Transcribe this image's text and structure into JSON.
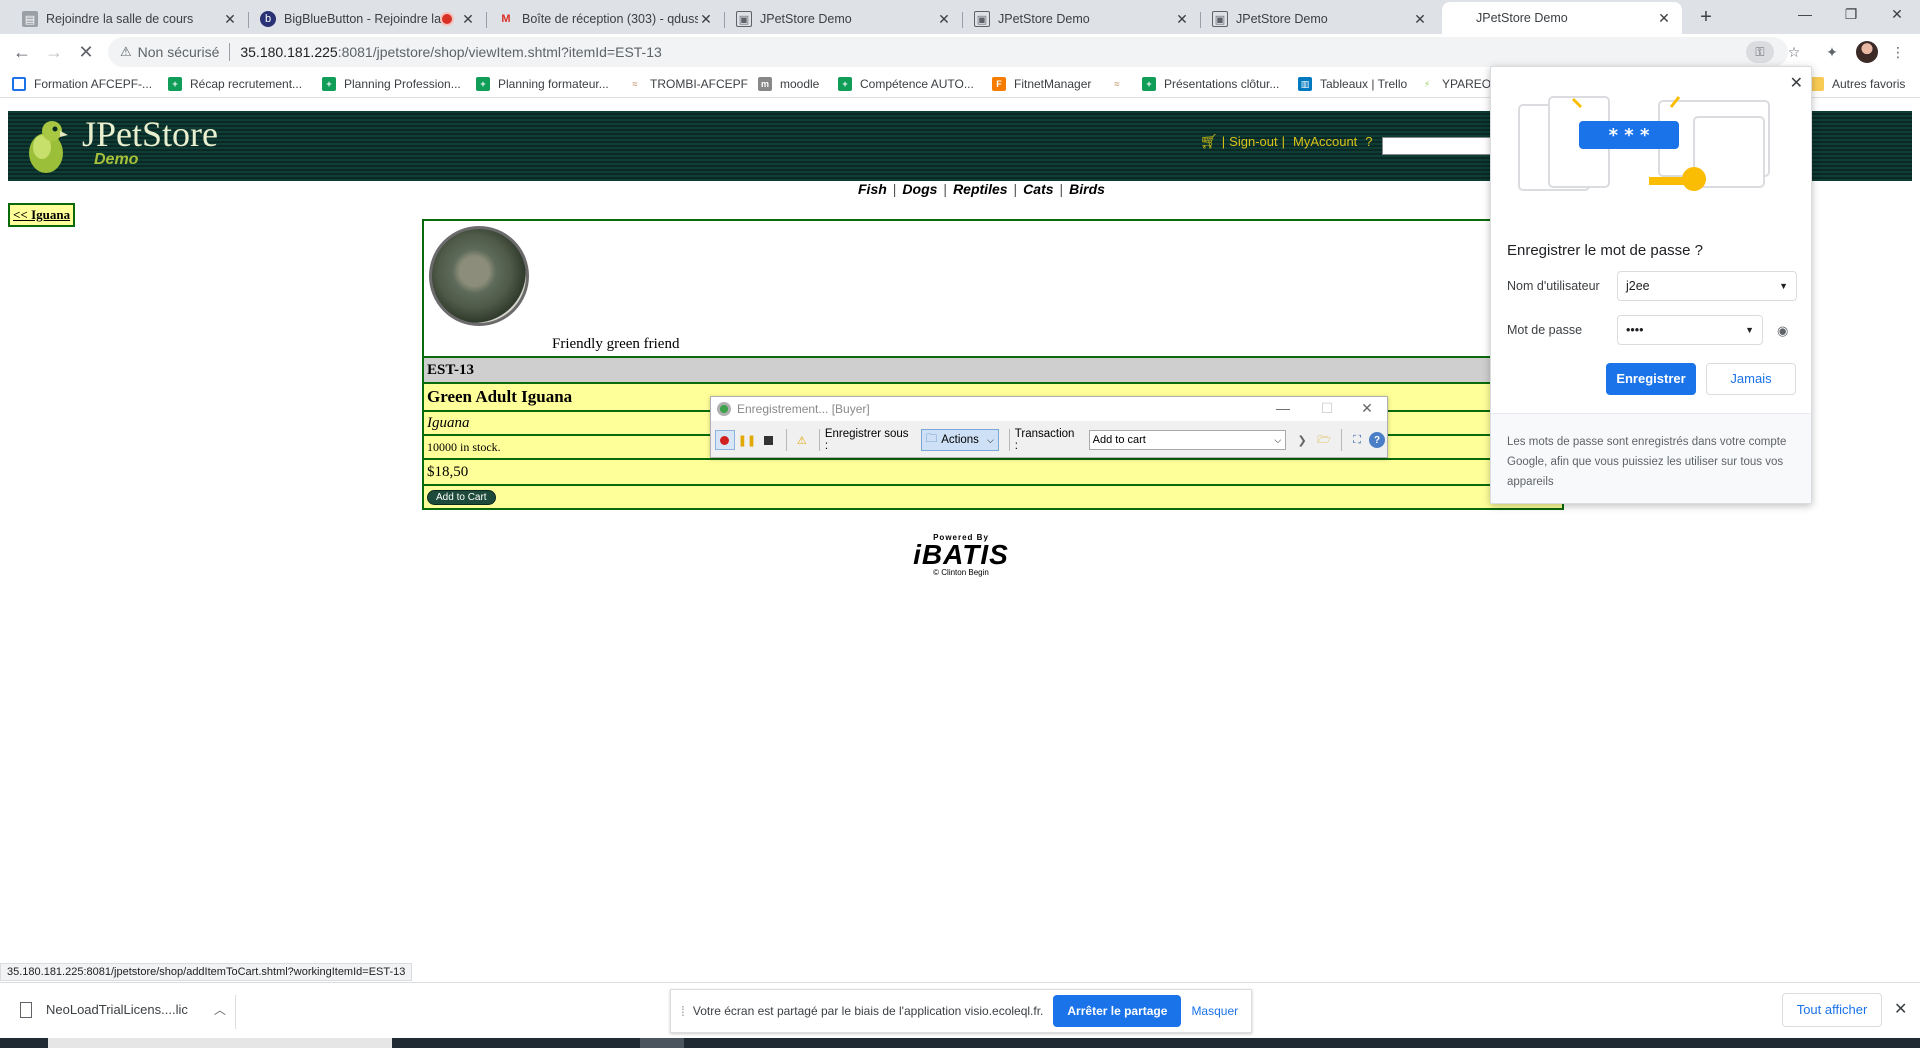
{
  "browser": {
    "tabs": [
      {
        "title": "Rejoindre la salle de cours",
        "active": false
      },
      {
        "title": "BigBlueButton - Rejoindre la",
        "active": false,
        "recording": true
      },
      {
        "title": "Boîte de réception (303) - qdusse",
        "active": false
      },
      {
        "title": "JPetStore Demo",
        "active": false
      },
      {
        "title": "JPetStore Demo",
        "active": false
      },
      {
        "title": "JPetStore Demo",
        "active": false
      },
      {
        "title": "JPetStore Demo",
        "active": true
      }
    ],
    "new_tab": "+",
    "security_label": "Non sécurisé",
    "url_host": "35.180.181.225",
    "url_rest": ":8081/jpetstore/shop/viewItem.shtml?itemId=EST-13",
    "bookmarks": [
      {
        "label": "Formation AFCEPF-...",
        "color": "#1a73e8"
      },
      {
        "label": "Récap recrutement...",
        "color": "#0f9d58"
      },
      {
        "label": "Planning Profession...",
        "color": "#0f9d58"
      },
      {
        "label": "Planning formateur...",
        "color": "#0f9d58"
      },
      {
        "label": "TROMBI-AFCEPF",
        "color": "#c9a27a"
      },
      {
        "label": "moodle",
        "color": "#888888"
      },
      {
        "label": "Compétence AUTO...",
        "color": "#0f9d58"
      },
      {
        "label": "FitnetManager",
        "color": "#f57c00"
      },
      {
        "label": "",
        "color": "#c9a27a"
      },
      {
        "label": "Présentations clôtur...",
        "color": "#0f9d58"
      },
      {
        "label": "Tableaux | Trello",
        "color": "#0079bf"
      },
      {
        "label": "YPAREO",
        "color": "#9ccc65"
      }
    ],
    "other_bookmarks": "Autres favoris"
  },
  "store": {
    "logo_title": "JPetStore",
    "logo_sub": "Demo",
    "menu": {
      "signout": "Sign-out",
      "myaccount": "MyAccount",
      "help": "?",
      "sep": "|"
    },
    "categories": [
      "Fish",
      "Dogs",
      "Reptiles",
      "Cats",
      "Birds"
    ],
    "category_sep": "|",
    "back_link": "<< Iguana",
    "item": {
      "description": "Friendly green friend",
      "id": "EST-13",
      "name": "Green Adult Iguana",
      "product": "Iguana",
      "stock": "10000 in stock.",
      "price": "$18,50",
      "add_to_cart": "Add to Cart"
    },
    "footer": {
      "powered_by": "Powered By",
      "brand": "iBATIS",
      "credit": "© Clinton Begin"
    }
  },
  "recorder": {
    "title": "Enregistrement... [Buyer]",
    "save_as_label": "Enregistrer sous :",
    "actions_label": "Actions",
    "transaction_label": "Transaction :",
    "transaction_value": "Add to cart"
  },
  "password_popup": {
    "title": "Enregistrer le mot de passe ?",
    "username_label": "Nom d'utilisateur",
    "username_value": "j2ee",
    "password_label": "Mot de passe",
    "password_value": "••••",
    "save_button": "Enregistrer",
    "never_button": "Jamais",
    "footer": "Les mots de passe sont enregistrés dans votre compte Google, afin que vous puissiez les utiliser sur tous vos appareils",
    "illus_text": "* * *"
  },
  "status_url": "35.180.181.225:8081/jpetstore/shop/addItemToCart.shtml?workingItemId=EST-13",
  "shelf": {
    "download_name": "NeoLoadTrialLicens....lic",
    "share_text": "Votre écran est partagé par le biais de l'application visio.ecoleql.fr.",
    "stop_share": "Arrêter le partage",
    "hide": "Masquer",
    "show_all": "Tout afficher"
  }
}
